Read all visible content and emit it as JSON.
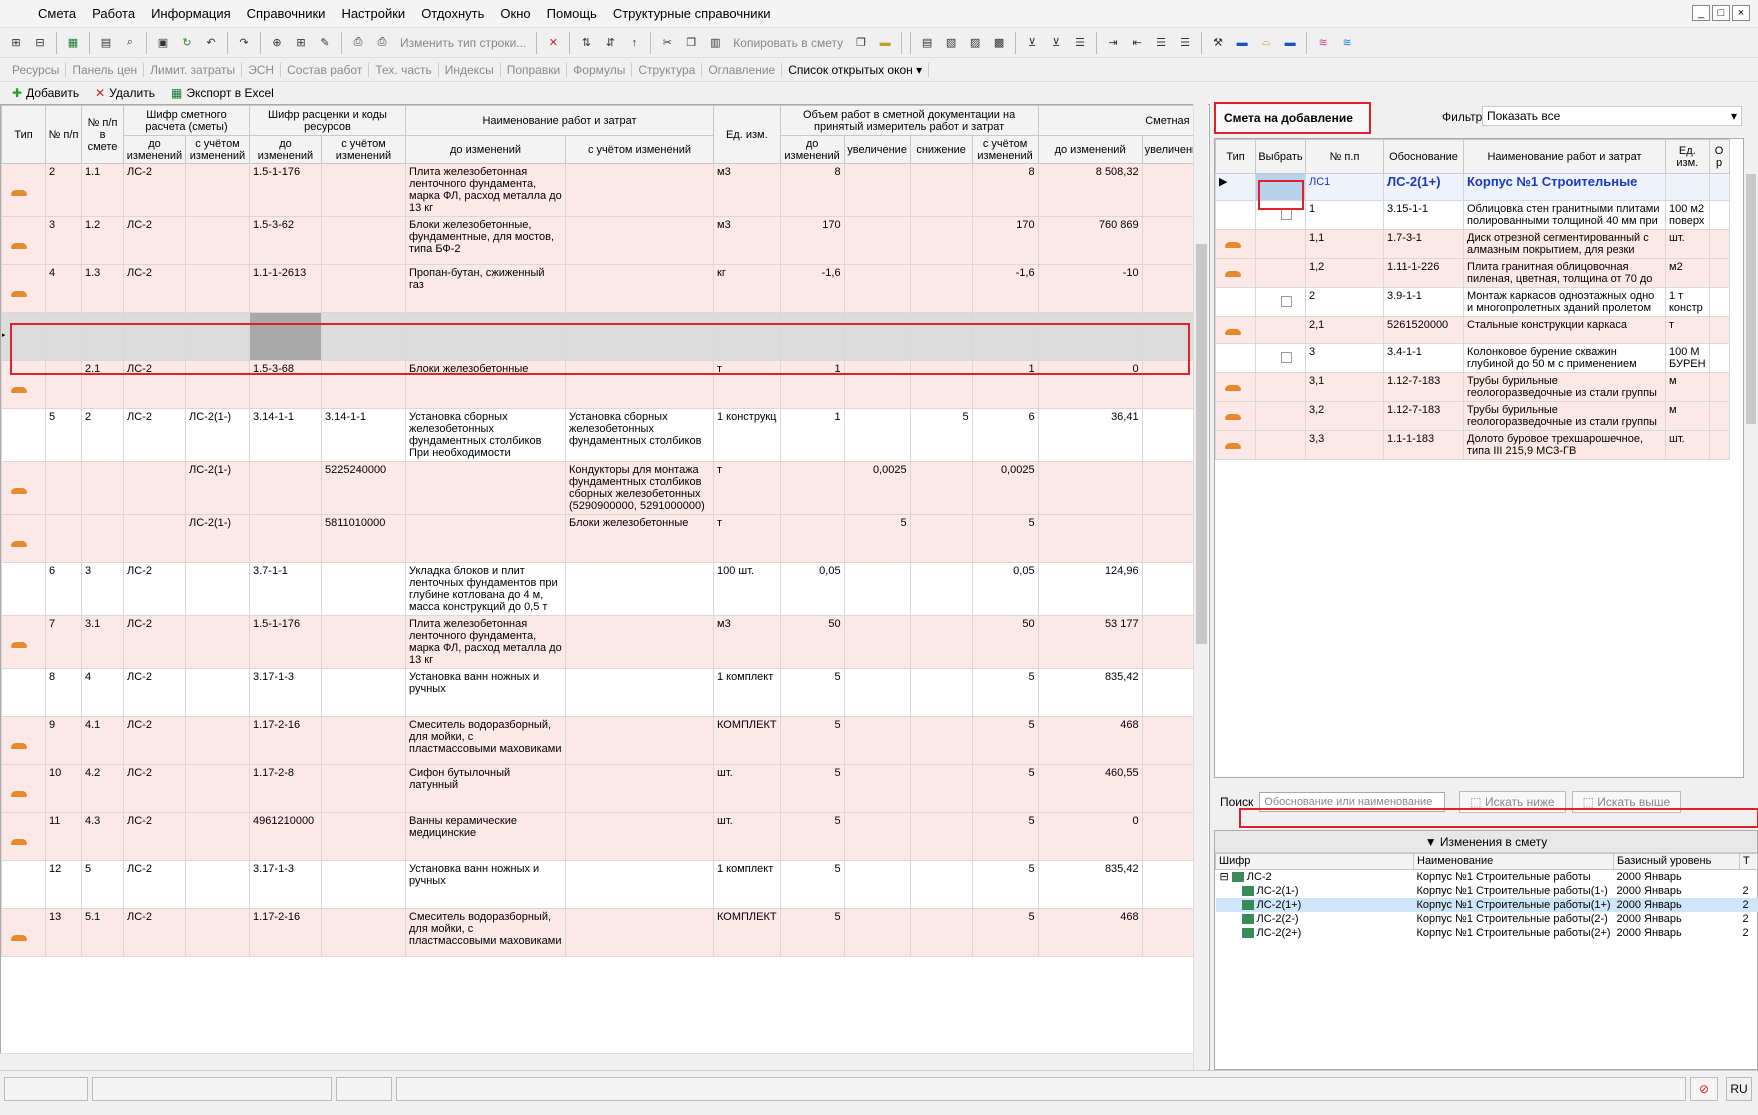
{
  "menu": [
    "Смета",
    "Работа",
    "Информация",
    "Справочники",
    "Настройки",
    "Отдохнуть",
    "Окно",
    "Помощь",
    "Структурные справочники"
  ],
  "window_controls": [
    "_",
    "□",
    "×"
  ],
  "toolbar1": {
    "change_type": "Изменить тип строки...",
    "copy_to_estimate": "Копировать в смету"
  },
  "toolbar2": [
    "Ресурсы",
    "Панель цен",
    "Лимит. затраты",
    "ЭСН",
    "Состав работ",
    "Тех. часть",
    "Индексы",
    "Поправки",
    "Формулы",
    "Структура",
    "Оглавление",
    "Список открытых окон ▾"
  ],
  "toolbar3": {
    "add": "Добавить",
    "delete": "Удалить",
    "export": "Экспорт в Excel"
  },
  "left_headers": {
    "type": "Тип",
    "pp": "№ п/п",
    "pp_in": "№ п/п в смете",
    "cipher_estimate": "Шифр сметного расчета (сметы)",
    "cipher_rates": "Шифр расценки и коды ресурсов",
    "name": "Наименование работ и затрат",
    "unit": "Ед. изм.",
    "volume": "Объем работ в сметной документации на принятый измеритель работ и затрат",
    "cost": "Сметная с",
    "before": "до изменений",
    "after": "с учётом изменений",
    "increase": "увеличение",
    "decrease": "снижение",
    "increase2": "увеличени"
  },
  "left_rows": [
    {
      "style": "pink",
      "icon": true,
      "pp": "2",
      "pp_in": "1.1",
      "c1": "ЛС-2",
      "c2": "",
      "r1": "1.5-1-176",
      "r2": "",
      "n1": "Плита железобетонная ленточного фундамента, марка ФЛ, расход металла до 13 кг",
      "n2": "",
      "unit": "м3",
      "v1": "8",
      "vi": "",
      "vd": "",
      "v2": "8",
      "s1": "8 508,32"
    },
    {
      "style": "pink",
      "icon": true,
      "pp": "3",
      "pp_in": "1.2",
      "c1": "ЛС-2",
      "c2": "",
      "r1": "1.5-3-62",
      "r2": "",
      "n1": "Блоки железобетонные, фундаментные, для мостов, типа БФ-2",
      "n2": "",
      "unit": "м3",
      "v1": "170",
      "vi": "",
      "vd": "",
      "v2": "170",
      "s1": "760 869"
    },
    {
      "style": "pink",
      "icon": true,
      "pp": "4",
      "pp_in": "1.3",
      "c1": "ЛС-2",
      "c2": "",
      "r1": "1.1-1-2613",
      "r2": "",
      "n1": "Пропан-бутан, сжиженный газ",
      "n2": "",
      "unit": "кг",
      "v1": "-1,6",
      "vi": "",
      "vd": "",
      "v2": "-1,6",
      "s1": "-10"
    },
    {
      "style": "sel",
      "icon": false,
      "pp": "",
      "pp_in": "",
      "c1": "",
      "c2": "",
      "r1": "",
      "r2": "",
      "n1": "",
      "n2": "",
      "unit": "",
      "v1": "",
      "vi": "",
      "vd": "",
      "v2": "",
      "s1": ""
    },
    {
      "style": "pink",
      "icon": true,
      "pp": "",
      "pp_in": "2.1",
      "c1": "ЛС-2",
      "c2": "",
      "r1": "1.5-3-68",
      "r2": "",
      "n1": "Блоки железобетонные",
      "n2": "",
      "unit": "т",
      "v1": "1",
      "vi": "",
      "vd": "",
      "v2": "1",
      "s1": "0"
    },
    {
      "style": "white",
      "icon": false,
      "pp": "5",
      "pp_in": "2",
      "c1": "ЛС-2",
      "c2": "ЛС-2(1-)",
      "r1": "3.14-1-1",
      "r2": "3.14-1-1",
      "n1": "Установка сборных железобетонных фундаментных столбиков При необходимости",
      "n2": "Установка сборных железобетонных фундаментных столбиков",
      "unit": "1 конструкц",
      "v1": "1",
      "vi": "",
      "vd": "5",
      "v2": "6",
      "s1": "36,41"
    },
    {
      "style": "pink",
      "icon": true,
      "pp": "",
      "pp_in": "",
      "c1": "",
      "c2": "ЛС-2(1-)",
      "r1": "",
      "r2": "5225240000",
      "n1": "",
      "n2": "Кондукторы для монтажа фундаментных столбиков сборных железобетонных (5290900000, 5291000000)",
      "unit": "т",
      "v1": "",
      "vi": "0,0025",
      "vd": "",
      "v2": "0,0025",
      "s1": ""
    },
    {
      "style": "pink",
      "icon": true,
      "pp": "",
      "pp_in": "",
      "c1": "",
      "c2": "ЛС-2(1-)",
      "r1": "",
      "r2": "5811010000",
      "n1": "",
      "n2": "Блоки железобетонные",
      "unit": "т",
      "v1": "",
      "vi": "5",
      "vd": "",
      "v2": "5",
      "s1": ""
    },
    {
      "style": "white",
      "icon": false,
      "pp": "6",
      "pp_in": "3",
      "c1": "ЛС-2",
      "c2": "",
      "r1": "3.7-1-1",
      "r2": "",
      "n1": "Укладка блоков и плит ленточных фундаментов при глубине котлована до 4 м, масса конструкций до 0,5 т",
      "n2": "",
      "unit": "100 шт.",
      "v1": "0,05",
      "vi": "",
      "vd": "",
      "v2": "0,05",
      "s1": "124,96"
    },
    {
      "style": "pink",
      "icon": true,
      "pp": "7",
      "pp_in": "3.1",
      "c1": "ЛС-2",
      "c2": "",
      "r1": "1.5-1-176",
      "r2": "",
      "n1": "Плита железобетонная ленточного фундамента, марка ФЛ, расход металла до 13 кг",
      "n2": "",
      "unit": "м3",
      "v1": "50",
      "vi": "",
      "vd": "",
      "v2": "50",
      "s1": "53 177"
    },
    {
      "style": "white",
      "icon": false,
      "pp": "8",
      "pp_in": "4",
      "c1": "ЛС-2",
      "c2": "",
      "r1": "3.17-1-3",
      "r2": "",
      "n1": "Установка ванн ножных и ручных",
      "n2": "",
      "unit": "1 комплект",
      "v1": "5",
      "vi": "",
      "vd": "",
      "v2": "5",
      "s1": "835,42"
    },
    {
      "style": "pink",
      "icon": true,
      "pp": "9",
      "pp_in": "4.1",
      "c1": "ЛС-2",
      "c2": "",
      "r1": "1.17-2-16",
      "r2": "",
      "n1": "Смеситель водоразборный, для мойки, с пластмассовыми маховиками",
      "n2": "",
      "unit": "КОМПЛЕКТ",
      "v1": "5",
      "vi": "",
      "vd": "",
      "v2": "5",
      "s1": "468"
    },
    {
      "style": "pink",
      "icon": true,
      "pp": "10",
      "pp_in": "4.2",
      "c1": "ЛС-2",
      "c2": "",
      "r1": "1.17-2-8",
      "r2": "",
      "n1": "Сифон бутылочный латунный",
      "n2": "",
      "unit": "шт.",
      "v1": "5",
      "vi": "",
      "vd": "",
      "v2": "5",
      "s1": "460,55"
    },
    {
      "style": "pink",
      "icon": true,
      "pp": "11",
      "pp_in": "4.3",
      "c1": "ЛС-2",
      "c2": "",
      "r1": "4961210000",
      "r2": "",
      "n1": "Ванны керамические медицинские",
      "n2": "",
      "unit": "шт.",
      "v1": "5",
      "vi": "",
      "vd": "",
      "v2": "5",
      "s1": "0"
    },
    {
      "style": "white",
      "icon": false,
      "pp": "12",
      "pp_in": "5",
      "c1": "ЛС-2",
      "c2": "",
      "r1": "3.17-1-3",
      "r2": "",
      "n1": "Установка ванн ножных и ручных",
      "n2": "",
      "unit": "1 комплект",
      "v1": "5",
      "vi": "",
      "vd": "",
      "v2": "5",
      "s1": "835,42"
    },
    {
      "style": "pink",
      "icon": true,
      "pp": "13",
      "pp_in": "5.1",
      "c1": "ЛС-2",
      "c2": "",
      "r1": "1.17-2-16",
      "r2": "",
      "n1": "Смеситель водоразборный, для мойки, с пластмассовыми маховиками",
      "n2": "",
      "unit": "КОМПЛЕКТ",
      "v1": "5",
      "vi": "",
      "vd": "",
      "v2": "5",
      "s1": "468"
    }
  ],
  "right": {
    "title": "Смета на добавление",
    "filter_label": "Фильтр",
    "filter_value": "Показать все",
    "headers": {
      "type": "Тип",
      "select": "Выбрать",
      "pp": "№ п.п",
      "basis": "Обоснование",
      "name": "Наименование работ и затрат",
      "unit": "Ед. изм.",
      "o": "О р"
    },
    "rows": [
      {
        "style": "blue",
        "icon": false,
        "cb": false,
        "pp": "ЛС1",
        "basis": "ЛС-2(1+)",
        "name": "Корпус №1 Строительные",
        "unit": "",
        "bold": true
      },
      {
        "style": "white",
        "icon": false,
        "cb": true,
        "pp": "1",
        "basis": "3.15-1-1",
        "name": "Облицовка стен гранитными плитами полированными толщиной 40 мм при",
        "unit": "100 м2 поверх",
        "bold": false
      },
      {
        "style": "pink",
        "icon": true,
        "cb": false,
        "pp": "1,1",
        "basis": "1.7-3-1",
        "name": "Диск отрезной сегментированный с алмазным покрытием, для резки",
        "unit": "шт.",
        "bold": false
      },
      {
        "style": "pink",
        "icon": true,
        "cb": false,
        "pp": "1,2",
        "basis": "1.11-1-226",
        "name": "Плита гранитная облицовочная пиленая, цветная, толщина от 70 до",
        "unit": "м2",
        "bold": false
      },
      {
        "style": "white",
        "icon": false,
        "cb": true,
        "pp": "2",
        "basis": "3.9-1-1",
        "name": "Монтаж каркасов одноэтажных одно и многопролетных зданий пролетом",
        "unit": "1 т констр",
        "bold": false
      },
      {
        "style": "pink",
        "icon": true,
        "cb": false,
        "pp": "2,1",
        "basis": "5261520000",
        "name": "Стальные конструкции каркаса",
        "unit": "т",
        "bold": false
      },
      {
        "style": "white",
        "icon": false,
        "cb": true,
        "pp": "3",
        "basis": "3.4-1-1",
        "name": "Колонковое бурение скважин глубиной до 50 м с применением",
        "unit": "100 М БУРЕН",
        "bold": false
      },
      {
        "style": "pink",
        "icon": true,
        "cb": false,
        "pp": "3,1",
        "basis": "1.12-7-183",
        "name": "Трубы бурильные геологоразведочные из стали группы",
        "unit": "м",
        "bold": false
      },
      {
        "style": "pink",
        "icon": true,
        "cb": false,
        "pp": "3,2",
        "basis": "1.12-7-183",
        "name": "Трубы бурильные геологоразведочные из стали группы",
        "unit": "м",
        "bold": false
      },
      {
        "style": "pink",
        "icon": true,
        "cb": false,
        "pp": "3,3",
        "basis": "1.1-1-183",
        "name": "Долото буровое трехшарошечное, типа III 215,9 МС3-ГВ",
        "unit": "шт.",
        "bold": false
      }
    ],
    "search_label": "Поиск",
    "search_placeholder": "Обоснование или наименование",
    "search_down": "Искать ниже",
    "search_up": "Искать выше",
    "changes_title": "Изменения в смету",
    "changes_headers": {
      "cipher": "Шифр",
      "name": "Наименование",
      "level": "Базисный уровень",
      "t": "Т"
    },
    "changes_rows": [
      {
        "indent": 0,
        "cipher": "ЛС-2",
        "name": "Корпус №1 Строительные работы",
        "level": "2000 Январь",
        "t": "",
        "hl": false,
        "prefix": "⊟"
      },
      {
        "indent": 1,
        "cipher": "ЛС-2(1-)",
        "name": "Корпус №1 Строительные работы(1-)",
        "level": "2000 Январь",
        "t": "2",
        "hl": false,
        "prefix": ""
      },
      {
        "indent": 1,
        "cipher": "ЛС-2(1+)",
        "name": "Корпус №1 Строительные работы(1+)",
        "level": "2000 Январь",
        "t": "2",
        "hl": true,
        "prefix": ""
      },
      {
        "indent": 1,
        "cipher": "ЛС-2(2-)",
        "name": "Корпус №1 Строительные работы(2-)",
        "level": "2000 Январь",
        "t": "2",
        "hl": false,
        "prefix": ""
      },
      {
        "indent": 1,
        "cipher": "ЛС-2(2+)",
        "name": "Корпус №1 Строительные работы(2+)",
        "level": "2000 Январь",
        "t": "2",
        "hl": false,
        "prefix": ""
      }
    ]
  },
  "status": {
    "lang": "RU"
  }
}
